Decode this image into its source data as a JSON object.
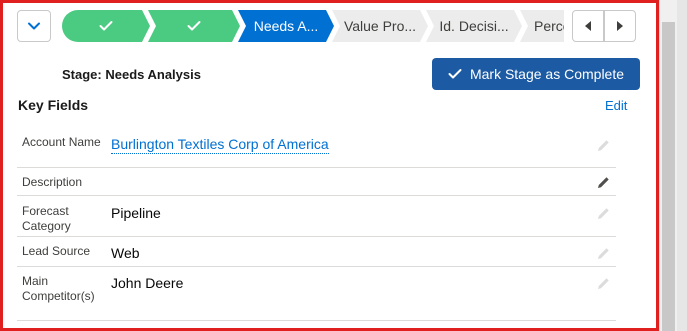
{
  "path": {
    "toggle_icon": "chevron-down-icon",
    "stages": [
      {
        "label": "",
        "status": "complete",
        "icon": "check-icon"
      },
      {
        "label": "",
        "status": "complete",
        "icon": "check-icon"
      },
      {
        "label": "Needs A...",
        "status": "current"
      },
      {
        "label": "Value Pro...",
        "status": "incomplete"
      },
      {
        "label": "Id. Decisi...",
        "status": "incomplete"
      },
      {
        "label": "Perce",
        "status": "incomplete"
      }
    ],
    "prev_icon": "caret-left-icon",
    "next_icon": "caret-right-icon"
  },
  "stage_header": {
    "title": "Stage: Needs Analysis",
    "complete_button_label": "Mark Stage as Complete",
    "complete_button_icon": "check-icon"
  },
  "key_fields": {
    "title": "Key Fields",
    "edit_label": "Edit",
    "fields": [
      {
        "label": "Account Name",
        "value": "Burlington Textiles Corp of America",
        "is_link": true,
        "pencil": "light"
      },
      {
        "label": "Description",
        "value": "",
        "is_link": false,
        "pencil": "dark"
      },
      {
        "label": "Forecast Category",
        "value": "Pipeline",
        "is_link": false,
        "pencil": "light"
      },
      {
        "label": "Lead Source",
        "value": "Web",
        "is_link": false,
        "pencil": "light"
      },
      {
        "label": "Main Competitor(s)",
        "value": "John Deere",
        "is_link": false,
        "pencil": "light"
      }
    ]
  },
  "colors": {
    "complete": "#4bca81",
    "current": "#0070d2",
    "incomplete": "#ececec",
    "button": "#1c5aa3",
    "frame_border": "#e0201f",
    "link": "#0070d2"
  }
}
